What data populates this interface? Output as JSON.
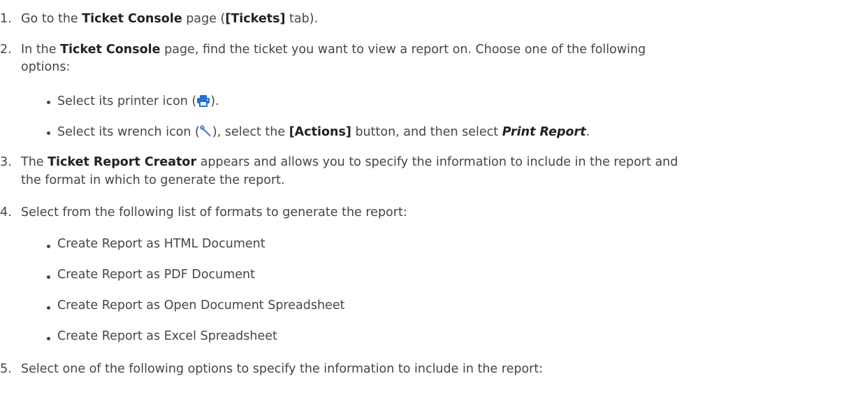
{
  "steps": [
    {
      "number": "1.",
      "parts": [
        "Go to the ",
        "Ticket Console",
        " page (",
        "[Tickets]",
        " tab)."
      ]
    },
    {
      "number": "2.",
      "parts": [
        "In the ",
        "Ticket Console",
        " page, find the ticket you want to view a report on. Choose one of the following"
      ],
      "line2": "options:",
      "bullets": [
        {
          "parts": [
            "Select its printer icon (",
            ")."
          ],
          "icon": "printer-icon"
        },
        {
          "parts": [
            "Select its wrench icon (",
            "), select the ",
            "[Actions]",
            " button, and then select ",
            "Print Report",
            "."
          ],
          "icon": "wrench-icon"
        }
      ]
    },
    {
      "number": "3.",
      "parts": [
        "The ",
        "Ticket Report Creator",
        " appears and allows you to specify the information to include in the report and"
      ],
      "line2": "the format in which to generate the report."
    },
    {
      "number": "4.",
      "text": "Select from the following list of formats to generate the report:",
      "bullets": [
        "Create Report as HTML Document",
        "Create Report as PDF Document",
        "Create Report as Open Document Spreadsheet",
        "Create Report as Excel Spreadsheet"
      ]
    },
    {
      "number": "5.",
      "text": "Select one of the following options to specify the information to include in the report:"
    }
  ],
  "colors": {
    "text": "#454545",
    "bold": "#222222",
    "icon_blue": "#2a6fd6"
  }
}
